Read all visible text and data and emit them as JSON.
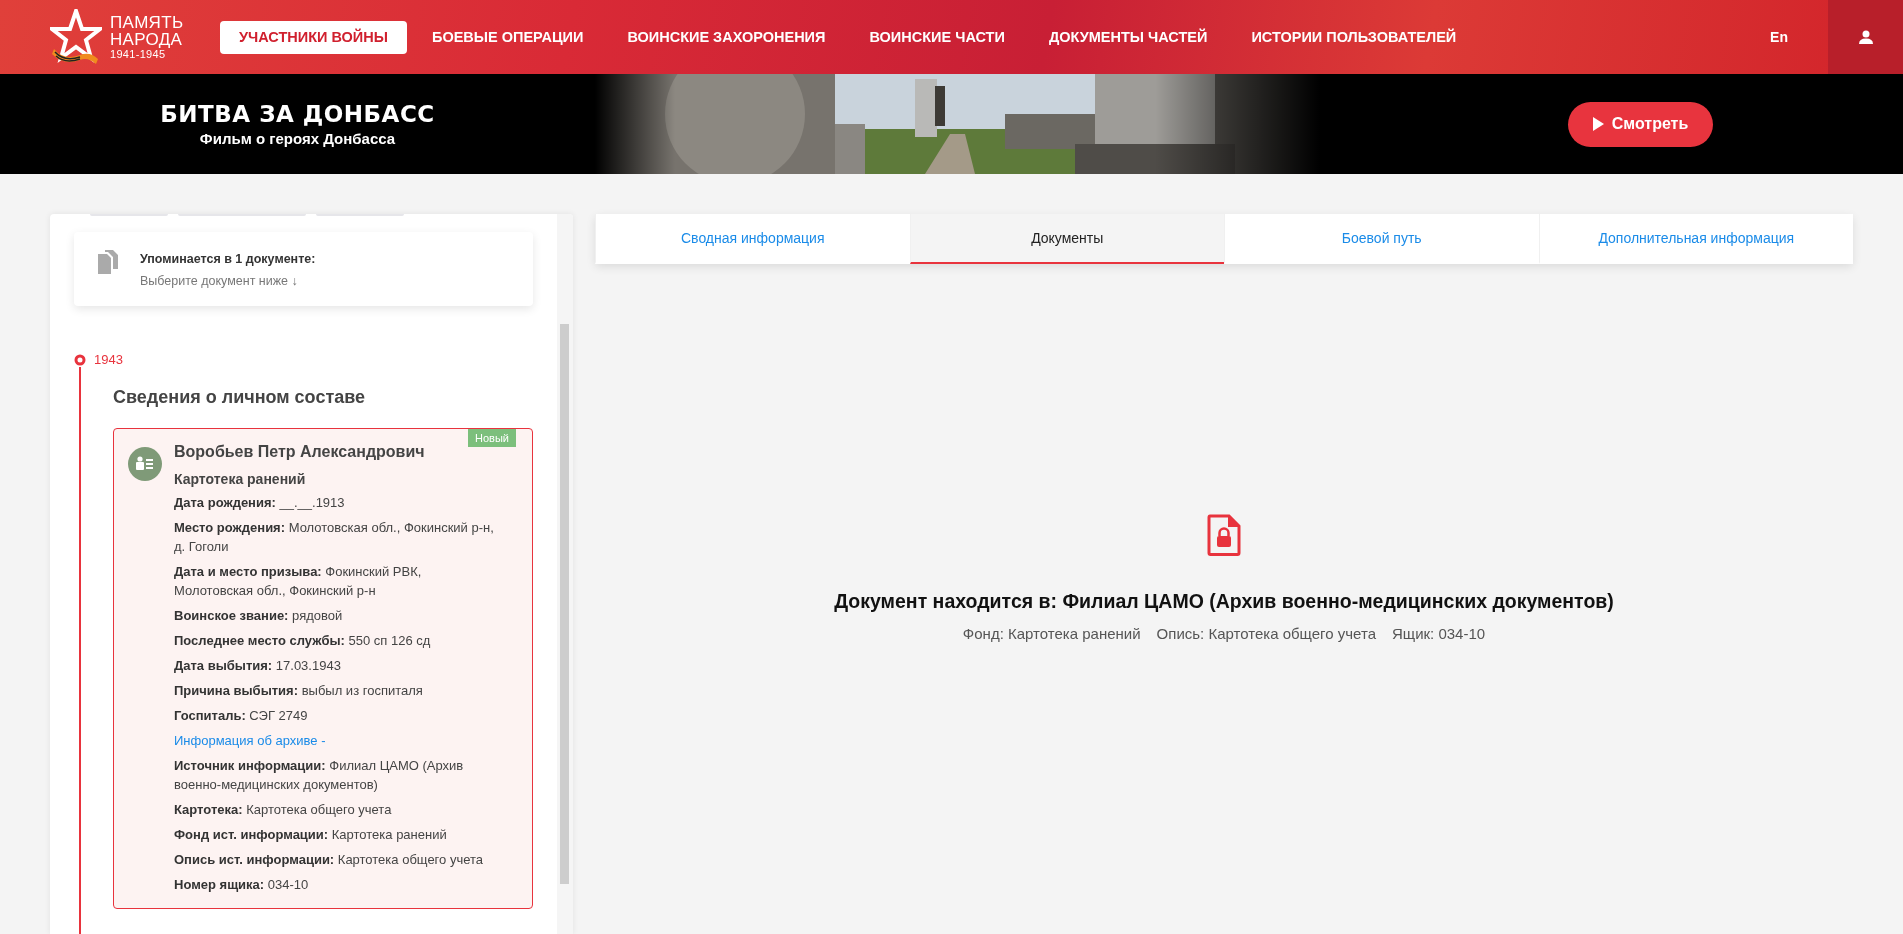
{
  "header": {
    "logo_lines": [
      "ПАМЯТЬ",
      "НАРОДА",
      "1941-1945"
    ],
    "nav": [
      {
        "label": "УЧАСТНИКИ ВОЙНЫ",
        "selected": true
      },
      {
        "label": "БОЕВЫЕ ОПЕРАЦИИ",
        "selected": false
      },
      {
        "label": "ВОИНСКИЕ ЗАХОРОНЕНИЯ",
        "selected": false
      },
      {
        "label": "ВОИНСКИЕ ЧАСТИ",
        "selected": false
      },
      {
        "label": "ДОКУМЕНТЫ ЧАСТЕЙ",
        "selected": false
      },
      {
        "label": "ИСТОРИИ ПОЛЬЗОВАТЕЛЕЙ",
        "selected": false
      }
    ],
    "language": "En"
  },
  "banner": {
    "title": "БИТВА ЗА ДОНБАСС",
    "subtitle": "Фильм о героях Донбасса",
    "button": "Смотреть"
  },
  "sidebar": {
    "mention": {
      "title": "Упоминается в 1 документе:",
      "hint": "Выберите документ ниже ↓"
    },
    "year": "1943",
    "section_title": "Сведения о личном составе",
    "record": {
      "name": "Воробьев Петр Александрович",
      "badge": "Новый",
      "type": "Картотека ранений",
      "fields": [
        {
          "kind": "field",
          "text": "**Дата рождения:** __.__.1913"
        },
        {
          "kind": "field",
          "text": "**Место рождения:** Молотовская обл., Фокинский р-н, д. Гоголи"
        },
        {
          "kind": "field",
          "text": "**Дата и место призыва:** Фокинский РВК, Молотовская обл., Фокинский р-н"
        },
        {
          "kind": "field",
          "text": "**Воинское звание:** рядовой"
        },
        {
          "kind": "field",
          "text": "**Последнее место службы:** 550 сп 126 сд"
        },
        {
          "kind": "field",
          "text": "**Дата выбытия:** 17.03.1943"
        },
        {
          "kind": "field",
          "text": "**Причина выбытия:** выбыл из госпиталя"
        },
        {
          "kind": "field",
          "text": "**Госпиталь:** СЭГ 2749"
        },
        {
          "kind": "link",
          "text": "Информация об архиве -"
        },
        {
          "kind": "field",
          "text": "**Источник информации:** Филиал ЦАМО (Архив военно-медицинских документов)"
        },
        {
          "kind": "field",
          "text": "**Картотека:** Картотека общего учета"
        },
        {
          "kind": "field",
          "text": "**Фонд ист. информации:** Картотека ранений"
        },
        {
          "kind": "field",
          "text": "**Опись ист. информации:** Картотека общего учета"
        },
        {
          "kind": "field",
          "text": "**Номер ящика:** 034-10"
        }
      ]
    }
  },
  "tabs": [
    {
      "label": "Сводная информация",
      "selected": false
    },
    {
      "label": "Документы",
      "selected": true
    },
    {
      "label": "Боевой путь",
      "selected": false
    },
    {
      "label": "Дополнительная информация",
      "selected": false
    }
  ],
  "document": {
    "title": "Документ находится в: Филиал ЦАМО (Архив военно-медицинских документов)",
    "details": [
      "Фонд: Картотека ранений",
      "Опись: Картотека общего учета",
      "Ящик: 034-10"
    ]
  }
}
